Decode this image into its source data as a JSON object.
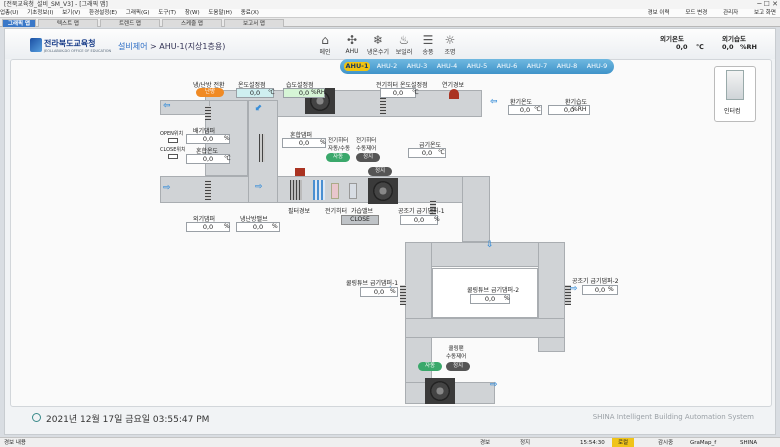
{
  "window": {
    "title": "[전북교육청_설비_SM_V3] - [그래픽 맵]"
  },
  "menu": [
    "업총(U)",
    "기초정보(I)",
    "보기(V)",
    "환경설정(E)",
    "그래픽(G)",
    "도구(T)",
    "창(W)",
    "도움말(H)",
    "종료(X)"
  ],
  "toolbar_right": [
    "경보 이력",
    "모드 변경",
    "관리자",
    "보고 화면"
  ],
  "tabs": [
    "그래픽 맵",
    "텍스트 맵",
    "트렌드 맵",
    "스케줄 맵",
    "보고서 맵"
  ],
  "header": {
    "logo_text": "전라북도교육청",
    "logo_sub": "JEOLLABUK-DO OFFICE OF EDUCATION",
    "breadcrumb_section": "설비제어",
    "breadcrumb_page": "AHU-1(지상1층용)"
  },
  "nav_icons": [
    {
      "label": "메인",
      "icon": "home-icon",
      "glyph": "⌂"
    },
    {
      "label": "AHU",
      "icon": "fan-icon",
      "glyph": "✣"
    },
    {
      "label": "냉온수기",
      "icon": "snowflake-icon",
      "glyph": "❄"
    },
    {
      "label": "보일러",
      "icon": "boiler-icon",
      "glyph": "♨"
    },
    {
      "label": "송풍",
      "icon": "blower-icon",
      "glyph": "☰"
    },
    {
      "label": "조명",
      "icon": "bulb-icon",
      "glyph": "☼"
    }
  ],
  "outdoor": {
    "temp_label": "외기온도",
    "temp_value": "0,0",
    "temp_unit": "℃",
    "hum_label": "외기습도",
    "hum_value": "0,0",
    "hum_unit": "%RH"
  },
  "ahu_tabs": [
    "AHU-1",
    "AHU-2",
    "AHU-3",
    "AHU-4",
    "AHU-5",
    "AHU-6",
    "AHU-7",
    "AHU-8",
    "AHU-9"
  ],
  "points": {
    "mode_label": "냉/난방 전환",
    "mode_btn": "난방",
    "temp_set_label": "온도설정점",
    "temp_set_value": "0,0",
    "temp_set_unit": "℃",
    "hum_set_label": "습도설정점",
    "hum_set_value": "0,0",
    "hum_set_unit": "%RH",
    "heater_temp_set_label": "전기히터 온도설정점",
    "heater_temp_set_value": "0,0",
    "heater_temp_set_unit": "℃",
    "smoke_label": "연기경보",
    "return_temp_label": "환기온도",
    "return_temp_value": "0,0",
    "return_temp_unit": "℃",
    "return_hum_label": "환기습도",
    "return_hum_value": "0,0",
    "return_hum_unit": "%RH",
    "exhaust_damper_label": "배기댐퍼",
    "exhaust_damper_value": "0,0",
    "exhaust_damper_unit": "%",
    "open_pos_label": "OPEN위치",
    "close_pos_label": "CLOSE위치",
    "mix_temp_label": "혼합온도",
    "mix_temp_value": "0,0",
    "mix_temp_unit": "℃",
    "mix_damper_label": "혼합댐퍼",
    "mix_damper_value": "0,0",
    "mix_damper_unit": "%",
    "heater_auto_label": "전기히터\n자동/수동",
    "heater_auto_btn": "자동",
    "heater_manual_label": "전기히터\n수동제어",
    "heater_manual_btn": "정지",
    "supply_fan_btn": "정지",
    "supply_temp_label": "급기온도",
    "supply_temp_value": "0,0",
    "supply_temp_unit": "℃",
    "oa_damper_label": "외기댐퍼",
    "oa_damper_value": "0,0",
    "oa_damper_unit": "%",
    "heat_valve_label": "냉난방밸브",
    "heat_valve_value": "0,0",
    "heat_valve_unit": "%",
    "filter_label": "필터경보",
    "heater_label": "전기히터",
    "humidifier_label": "가습밸브",
    "humidifier_state": "CLOSE",
    "supply_damper1_label": "공조기 급기댐퍼-1",
    "supply_damper1_value": "0,0",
    "supply_damper1_unit": "%",
    "cooling_damper1_label": "쿨링튜브 급기댐퍼-1",
    "cooling_damper1_value": "0,0",
    "cooling_damper1_unit": "%",
    "cooling_damper2_label": "쿨링튜브 급기댐퍼-2",
    "cooling_damper2_value": "0,0",
    "cooling_damper2_unit": "%",
    "supply_damper2_label": "공조기 급기댐퍼-2",
    "supply_damper2_value": "0,0",
    "supply_damper2_unit": "%",
    "cooling_fan_label": "쿨링팬\n수동제어",
    "cooling_fan_auto_btn": "자동",
    "cooling_fan_stop_btn": "정지",
    "inverter_label": "인터컴"
  },
  "footer": {
    "datetime": "2021년 12월 17일 금요일 03:55:47 PM",
    "brand": "SHINA Intelligent Building Automation System"
  },
  "statusbar": {
    "left": "경보 내용",
    "mid1": "경보",
    "mid2": "정지",
    "time": "15:54:30",
    "mode": "로컬",
    "monitor": "감시중",
    "user": "GraMap_f",
    "company": "SHINA SYSTEM"
  },
  "colors": {
    "accent": "#3a78c8",
    "green": "#3aa86b",
    "orange": "#f08a24",
    "duct": "#d0d3d6"
  }
}
